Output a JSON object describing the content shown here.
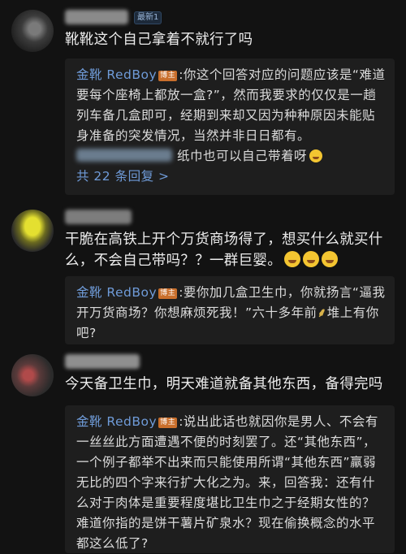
{
  "comments": [
    {
      "badge": "最新1",
      "text": "靴靴这个自己拿着不就行了吗",
      "reply": {
        "author": "金靴 RedBoy",
        "host_tag": "博主",
        "text": ":你这个回答对应的问题应该是“难道要每个座椅上都放一盒?”，然而我要求的仅仅是一趟列车备几盒即可，经期到来却又因为种种原因未能贴身准备的突发情况，当然并非日日都有。"
      },
      "sub_reply_text": "纸巾也可以自己带着呀",
      "more_replies": "共 22 条回复 >"
    },
    {
      "text": "干脆在高铁上开个万货商场得了，想买什么就买什么，不会自己带吗？？一群巨婴。",
      "reply": {
        "author": "金靴 RedBoy",
        "host_tag": "博主",
        "text_before": ":要你加几盒卫生巾，你就扬言“逼我开万货商场？你想麻烦死我！”六十多年前",
        "text_after": "堆上有你吧?"
      }
    },
    {
      "text": "今天备卫生巾，明天难道就备其他东西，备得完吗",
      "reply": {
        "author": "金靴 RedBoy",
        "host_tag": "博主",
        "text": ":说出此话也就因你是男人、不会有一丝丝此方面遭遇不便的时刻罢了。还“其他东西”，一个例子都举不出来而只能使用所谓“其他东西”羸弱无比的四个字来行扩大化之为。来，回答我：还有什么对于肉体是重要程度堪比卫生巾之于经期女性的？难道你指的是饼干薯片矿泉水？现在偷换概念的水平都这么低了?"
      }
    }
  ],
  "icons": [
    "avatar",
    "laughing-emoji",
    "grin-emoji",
    "rice-sheaf-icon"
  ]
}
